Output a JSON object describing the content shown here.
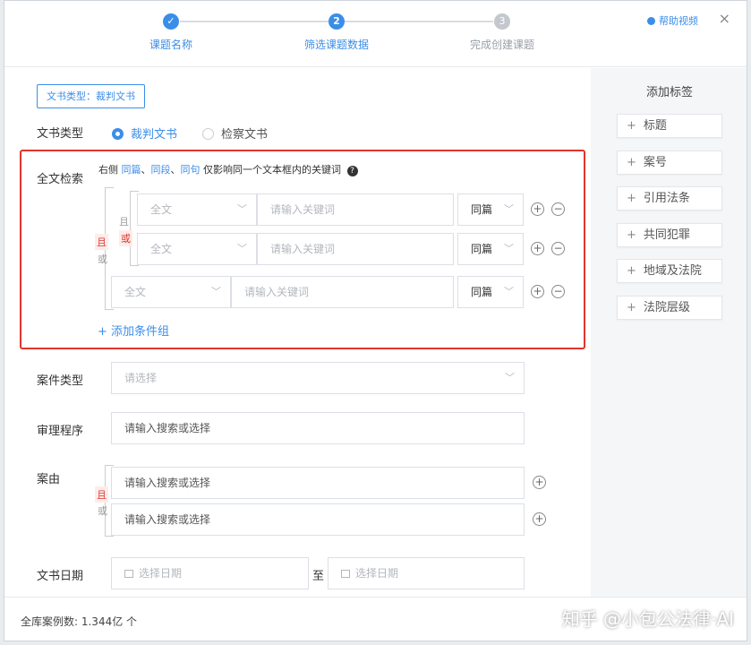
{
  "steps": [
    {
      "label": "课题名称",
      "num": "✓",
      "state": "done"
    },
    {
      "label": "筛选课题数据",
      "num": "2",
      "state": "active"
    },
    {
      "label": "完成创建课题",
      "num": "3",
      "state": "todo"
    }
  ],
  "header": {
    "help": "帮助视频",
    "close": "×"
  },
  "doc_type_tag": "文书类型：裁判文书",
  "doc_type": {
    "label": "文书类型",
    "options": [
      "裁判文书",
      "检察文书"
    ],
    "selected": "裁判文书"
  },
  "fulltext": {
    "label": "全文检索",
    "hint_prefix": "右侧",
    "hint_links": [
      "同篇",
      "同段",
      "同句"
    ],
    "hint_suffix": "仅影响同一个文本框内的关键词",
    "outer_and": "且",
    "outer_or": "或",
    "inner_and": "且",
    "inner_or": "或",
    "rows": [
      {
        "scope": "全文",
        "keyword_placeholder": "请输入关键词",
        "range": "同篇"
      },
      {
        "scope": "全文",
        "keyword_placeholder": "请输入关键词",
        "range": "同篇"
      },
      {
        "scope": "全文",
        "keyword_placeholder": "请输入关键词",
        "range": "同篇"
      }
    ],
    "add_group": "添加条件组"
  },
  "case_type": {
    "label": "案件类型",
    "placeholder": "请选择"
  },
  "procedure": {
    "label": "审理程序",
    "placeholder": "请输入搜索或选择"
  },
  "cause": {
    "label": "案由",
    "and": "且",
    "or": "或",
    "rows": [
      "请输入搜索或选择",
      "请输入搜索或选择"
    ]
  },
  "date": {
    "label": "文书日期",
    "from_placeholder": "选择日期",
    "sep": "至",
    "to_placeholder": "选择日期"
  },
  "right_panel": {
    "title": "添加标签",
    "tags": [
      "标题",
      "案号",
      "引用法条",
      "共同犯罪",
      "地域及法院",
      "法院层级"
    ]
  },
  "footer": {
    "count_text": "全库案例数:  1.344亿 个",
    "watermark": "知乎 @小包公法律·AI"
  },
  "colors": {
    "accent": "#3b8ee8",
    "highlight": "#e0352b"
  }
}
